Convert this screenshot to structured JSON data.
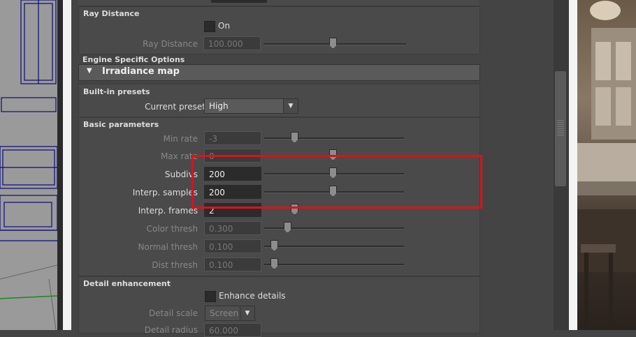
{
  "ray_distance_section": {
    "title": "Ray Distance",
    "on_label": "On",
    "field_label": "Ray Distance",
    "field_value": "100.000"
  },
  "engine_options": {
    "title": "Engine Specific Options",
    "rollout_title": "Irradiance map"
  },
  "presets": {
    "title": "Built-in presets",
    "label": "Current preset",
    "value": "High"
  },
  "basic_params": {
    "title": "Basic parameters",
    "rows": [
      {
        "label": "Min rate",
        "value": "-3"
      },
      {
        "label": "Max rate",
        "value": "0"
      },
      {
        "label": "Subdivs",
        "value": "200"
      },
      {
        "label": "Interp. samples",
        "value": "200"
      },
      {
        "label": "Interp. frames",
        "value": "2"
      },
      {
        "label": "Color thresh",
        "value": "0.300"
      },
      {
        "label": "Normal thresh",
        "value": "0.100"
      },
      {
        "label": "Dist thresh",
        "value": "0.100"
      }
    ]
  },
  "detail": {
    "title": "Detail enhancement",
    "checkbox_label": "Enhance details",
    "scale_label": "Detail scale",
    "scale_value": "Screen",
    "radius_label": "Detail radius",
    "radius_value": "60.000"
  },
  "colors": {
    "highlight": "#e0101a",
    "panel_bg": "#444444"
  }
}
